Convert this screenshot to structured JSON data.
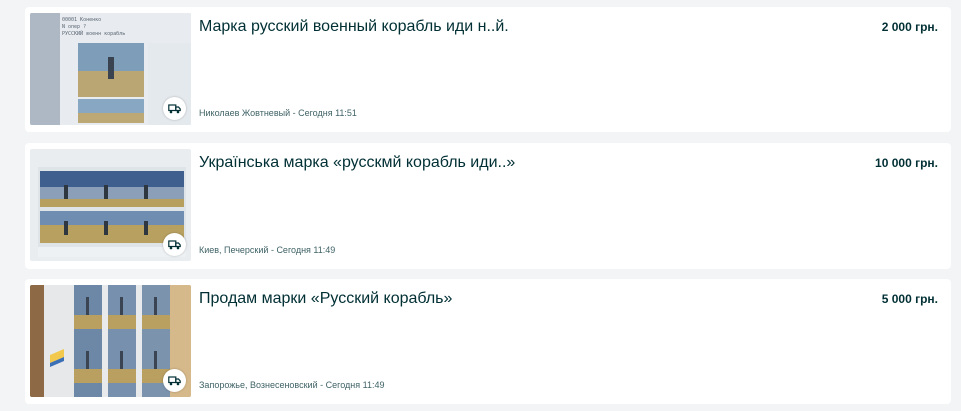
{
  "listings": [
    {
      "title": "Марка русский военный корабль иди н..й.",
      "price": "2 000 грн.",
      "location": "Николаев Жовтневый",
      "separator": " - ",
      "time": "Сегодня 11:51",
      "delivery_icon": "truck-icon"
    },
    {
      "title": "Українська марка «русскмй корабль иди..»",
      "price": "10 000 грн.",
      "location": "Киев, Печерский",
      "separator": " - ",
      "time": "Сегодня 11:49",
      "delivery_icon": "truck-icon"
    },
    {
      "title": "Продам марки «Русский корабль»",
      "price": "5 000 грн.",
      "location": "Запорожье, Вознесеновский",
      "separator": " - ",
      "time": "Сегодня 11:49",
      "delivery_icon": "truck-icon"
    }
  ],
  "colors": {
    "page_bg": "#f2f4f5",
    "card_bg": "#ffffff",
    "text": "#002f34",
    "meta_text": "#406367"
  }
}
